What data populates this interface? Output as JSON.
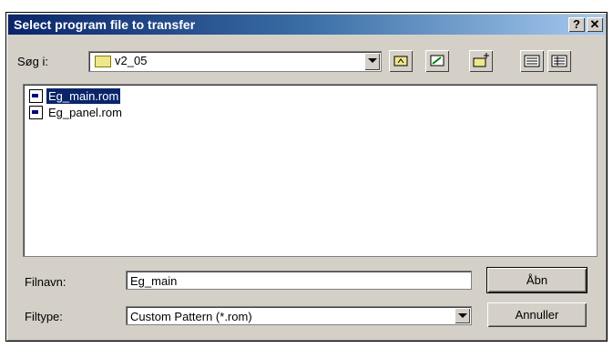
{
  "dialog": {
    "title": "Select program file to transfer",
    "help_label": "?",
    "close_label": "✕"
  },
  "lookin": {
    "label": "Søg i:",
    "value": "v2_05"
  },
  "toolbar": {
    "icons": [
      "up-folder-icon",
      "desktop-icon",
      "new-folder-icon",
      "list-view-icon",
      "details-view-icon"
    ]
  },
  "files": [
    {
      "name": "Eg_main.rom",
      "selected": true
    },
    {
      "name": "Eg_panel.rom",
      "selected": false
    }
  ],
  "filename": {
    "label": "Filnavn:",
    "value": "Eg_main"
  },
  "filetype": {
    "label": "Filtype:",
    "value": "Custom Pattern (*.rom)"
  },
  "buttons": {
    "open": "Åbn",
    "cancel": "Annuller"
  }
}
